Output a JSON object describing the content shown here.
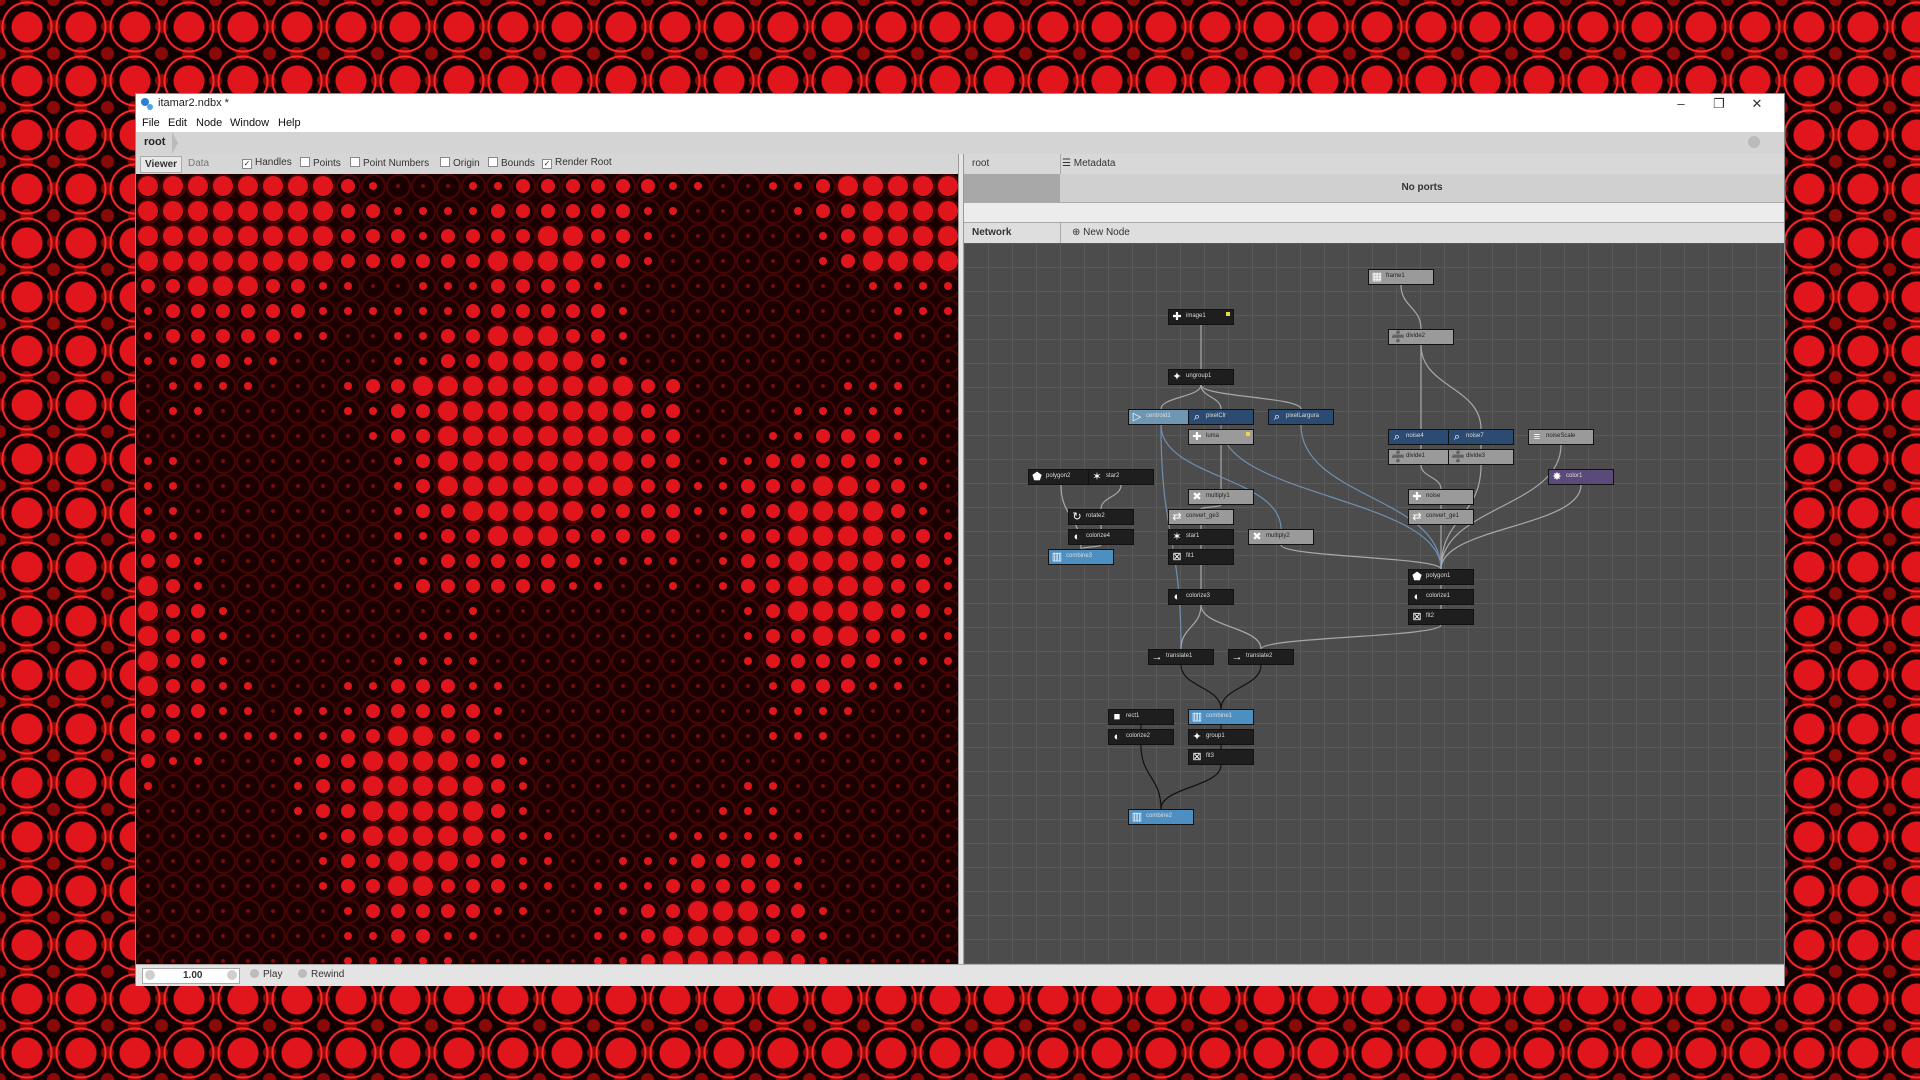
{
  "window": {
    "title": "itamar2.ndbx *"
  },
  "menu": [
    "File",
    "Edit",
    "Node",
    "Window",
    "Help"
  ],
  "address": {
    "crumb": "root"
  },
  "viewer": {
    "tabs": [
      "Viewer",
      "Data"
    ],
    "checks": [
      {
        "label": "Handles",
        "checked": true
      },
      {
        "label": "Points",
        "checked": false
      },
      {
        "label": "Point Numbers",
        "checked": false
      },
      {
        "label": "Origin",
        "checked": false
      },
      {
        "label": "Bounds",
        "checked": false
      },
      {
        "label": "Render Root",
        "checked": true
      }
    ]
  },
  "right": {
    "root_label": "root",
    "metadata_label": "Metadata",
    "no_ports": "No ports",
    "network_label": "Network",
    "new_node_label": "New Node"
  },
  "nodes": [
    {
      "label": "frame1",
      "icon": "frame-icon",
      "style": "light"
    },
    {
      "label": "divide2",
      "icon": "divide-icon",
      "style": "light"
    },
    {
      "label": "image1",
      "icon": "image-icon",
      "style": "dark",
      "flag": true
    },
    {
      "label": "ungroup1",
      "icon": "ungroup-icon",
      "style": "dark"
    },
    {
      "label": "centroid1",
      "icon": "centroid-icon",
      "style": "bluelt"
    },
    {
      "label": "pixelClr",
      "icon": "lookup-icon",
      "style": "blue"
    },
    {
      "label": "pixelLargura",
      "icon": "lookup-icon",
      "style": "blue"
    },
    {
      "label": "luma",
      "icon": "luma-icon",
      "style": "light",
      "flag": true
    },
    {
      "label": "noise4",
      "icon": "lookup-icon",
      "style": "blue"
    },
    {
      "label": "noise7",
      "icon": "lookup-icon",
      "style": "blue"
    },
    {
      "label": "noiseScale",
      "icon": "number-icon",
      "style": "light"
    },
    {
      "label": "divide1",
      "icon": "divide-icon",
      "style": "light"
    },
    {
      "label": "divide3",
      "icon": "divide-icon",
      "style": "light"
    },
    {
      "label": "polygon2",
      "icon": "polygon-icon",
      "style": "dark"
    },
    {
      "label": "star2",
      "icon": "star-icon",
      "style": "dark"
    },
    {
      "label": "color1",
      "icon": "color-icon",
      "style": "purple"
    },
    {
      "label": "multiply1",
      "icon": "multiply-icon",
      "style": "light"
    },
    {
      "label": "noise",
      "icon": "noise-icon",
      "style": "light"
    },
    {
      "label": "rotate2",
      "icon": "rotate-icon",
      "style": "dark"
    },
    {
      "label": "convert_ge3",
      "icon": "convert-icon",
      "style": "light"
    },
    {
      "label": "convert_ge1",
      "icon": "convert-icon",
      "style": "light"
    },
    {
      "label": "colorize4",
      "icon": "colorize-icon",
      "style": "dark"
    },
    {
      "label": "star1",
      "icon": "star-icon",
      "style": "dark"
    },
    {
      "label": "multiply2",
      "icon": "multiply-icon",
      "style": "light"
    },
    {
      "label": "combine3",
      "icon": "combine-icon",
      "style": "selected"
    },
    {
      "label": "fit1",
      "icon": "fit-icon",
      "style": "dark"
    },
    {
      "label": "polygon1",
      "icon": "polygon-icon",
      "style": "dark"
    },
    {
      "label": "colorize3",
      "icon": "colorize-icon",
      "style": "dark"
    },
    {
      "label": "colorize1",
      "icon": "colorize-icon",
      "style": "dark"
    },
    {
      "label": "fit2",
      "icon": "fit-icon",
      "style": "dark"
    },
    {
      "label": "translate1",
      "icon": "translate-icon",
      "style": "dark"
    },
    {
      "label": "translate2",
      "icon": "translate-icon",
      "style": "dark"
    },
    {
      "label": "rect1",
      "icon": "rect-icon",
      "style": "dark"
    },
    {
      "label": "combine1",
      "icon": "combine-icon",
      "style": "selected"
    },
    {
      "label": "colorize2",
      "icon": "colorize-icon",
      "style": "dark"
    },
    {
      "label": "group1",
      "icon": "group-icon",
      "style": "dark"
    },
    {
      "label": "fit3",
      "icon": "fit-icon",
      "style": "dark"
    },
    {
      "label": "combine2",
      "icon": "combine-icon",
      "style": "selected"
    }
  ],
  "bottom": {
    "frame": "1.00",
    "play": "Play",
    "rewind": "Rewind"
  },
  "colors": {
    "accent": "#e0161c",
    "network_bg": "#4c4c4c",
    "selected_node": "#4e8fc2"
  }
}
